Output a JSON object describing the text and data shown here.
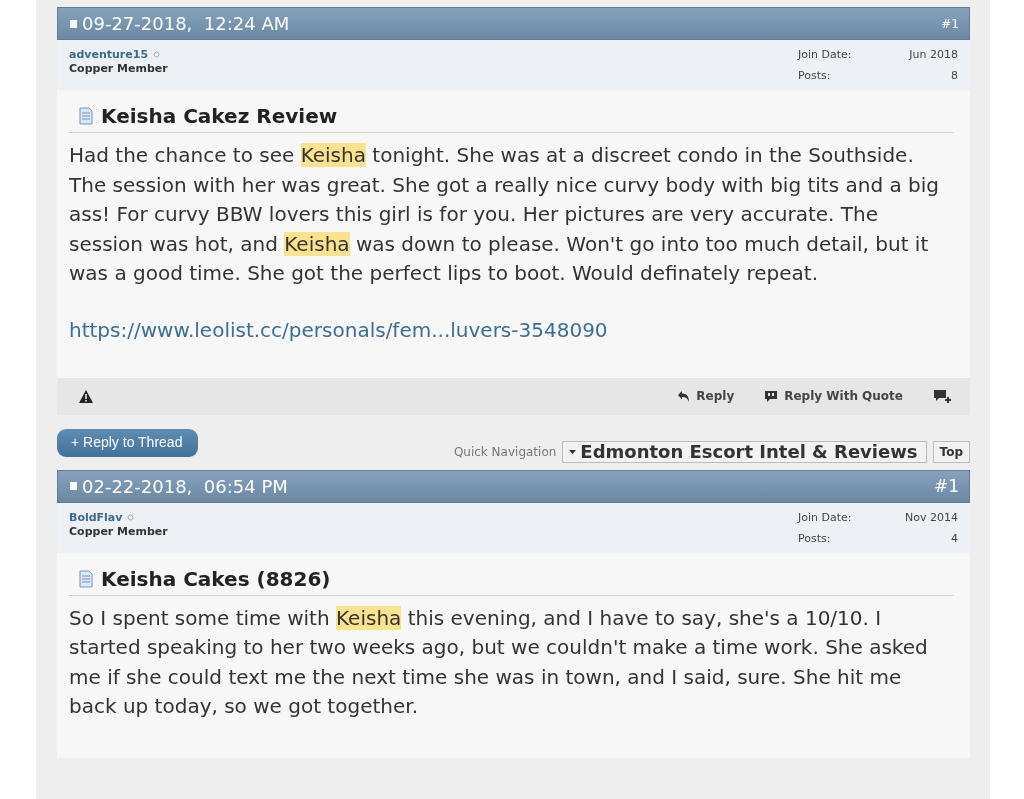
{
  "posts": [
    {
      "date": "09-27-2018,",
      "time": "12:24 AM",
      "number": "#1",
      "username": "adventure15",
      "user_title": "Copper Member",
      "join_date_label": "Join Date:",
      "join_date": "Jun 2018",
      "posts_label": "Posts:",
      "post_count": "8",
      "title": "Keisha Cakez Review",
      "body": [
        {
          "text": "Had the chance to see ",
          "highlighted": false
        },
        {
          "text": "Keisha",
          "highlighted": true
        },
        {
          "text": " tonight. She was at a discreet condo in the Southside. The session with her was great. She got a really nice curvy body with big tits and a big ass! For curvy BBW lovers this girl is for you. Her pictures are very accurate. The session was hot, and ",
          "highlighted": false
        },
        {
          "text": "Keisha",
          "highlighted": true
        },
        {
          "text": " was down to please. Won't go into too much detail, but it was a good time. She got the perfect lips to boot. Would definately repeat.",
          "highlighted": false
        }
      ],
      "link": "https://www.leolist.cc/personals/fem...luvers-3548090",
      "footer": {
        "reply": "Reply",
        "reply_with_quote": "Reply With Quote"
      }
    },
    {
      "date": "02-22-2018,",
      "time": "06:54 PM",
      "number": "#1",
      "username": "BoldFlav",
      "user_title": "Copper Member",
      "join_date_label": "Join Date:",
      "join_date": "Nov 2014",
      "posts_label": "Posts:",
      "post_count": "4",
      "title": "Keisha Cakes (8826)",
      "body": [
        {
          "text": "So I spent some time with ",
          "highlighted": false
        },
        {
          "text": "Keisha",
          "highlighted": true
        },
        {
          "text": " this evening, and I have to say, she's a 10/10. I started speaking to her two weeks ago, but we couldn't make a time work. She asked me if she could text me the next time she was in town, and I said, sure. She hit me back up today, so we got together.",
          "highlighted": false
        }
      ]
    }
  ],
  "thread_controls": {
    "reply_to_thread": "+ Reply to Thread",
    "quick_navigation_label": "Quick Navigation",
    "quick_navigation_value": "Edmonton Escort Intel & Reviews",
    "top": "Top"
  }
}
